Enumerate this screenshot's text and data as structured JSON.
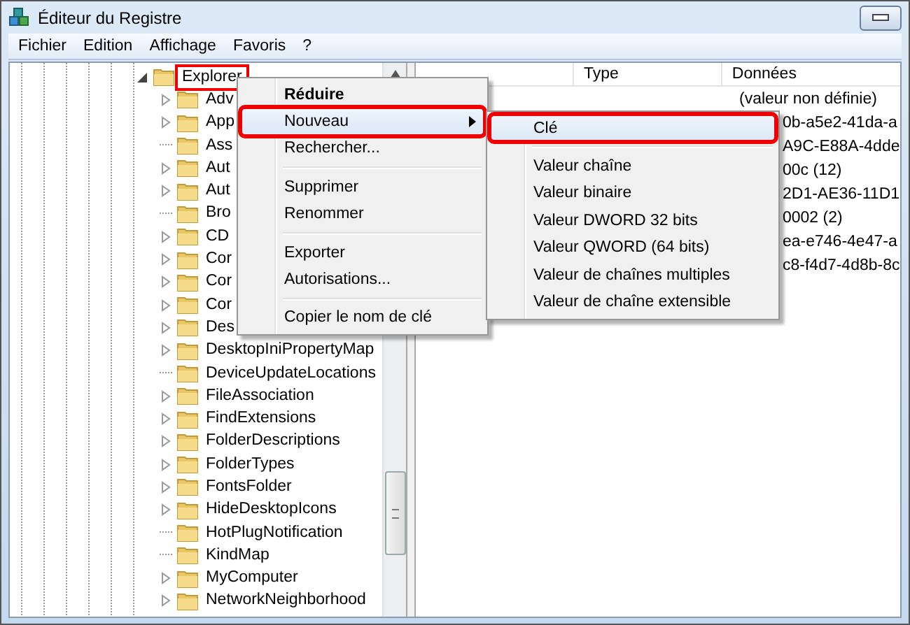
{
  "window": {
    "title": "Éditeur du Registre"
  },
  "menu_bar": [
    {
      "label": "Fichier"
    },
    {
      "label": "Edition"
    },
    {
      "label": "Affichage"
    },
    {
      "label": "Favoris"
    },
    {
      "label": "?"
    }
  ],
  "tree": {
    "items": [
      {
        "label": "Explorer",
        "expanded": true,
        "annotated": true,
        "children": [
          {
            "label": "Adv",
            "has_children": true
          },
          {
            "label": "App",
            "has_children": true
          },
          {
            "label": "Ass",
            "has_children": false
          },
          {
            "label": "Aut",
            "has_children": true
          },
          {
            "label": "Aut",
            "has_children": true
          },
          {
            "label": "Bro",
            "has_children": false
          },
          {
            "label": "CD",
            "has_children": true
          },
          {
            "label": "Cor",
            "has_children": true
          },
          {
            "label": "Cor",
            "has_children": true
          },
          {
            "label": "Cor",
            "has_children": true
          },
          {
            "label": "Des",
            "has_children": true
          },
          {
            "label": "DesktopIniPropertyMap",
            "has_children": true
          },
          {
            "label": "DeviceUpdateLocations",
            "has_children": false
          },
          {
            "label": "FileAssociation",
            "has_children": true
          },
          {
            "label": "FindExtensions",
            "has_children": true
          },
          {
            "label": "FolderDescriptions",
            "has_children": true
          },
          {
            "label": "FolderTypes",
            "has_children": true
          },
          {
            "label": "FontsFolder",
            "has_children": true
          },
          {
            "label": "HideDesktopIcons",
            "has_children": true
          },
          {
            "label": "HotPlugNotification",
            "has_children": false
          },
          {
            "label": "KindMap",
            "has_children": false
          },
          {
            "label": "MyComputer",
            "has_children": true
          },
          {
            "label": "NetworkNeighborhood",
            "has_children": true
          }
        ]
      }
    ]
  },
  "list": {
    "columns": [
      {
        "label": "Type"
      },
      {
        "label": "Données"
      }
    ],
    "rows": [
      {
        "data": "(valeur non définie)",
        "covered": false
      },
      {
        "data": "0b-a5e2-41da-a",
        "covered": true
      },
      {
        "data": "A9C-E88A-4dde",
        "covered": true
      },
      {
        "data": "00c (12)",
        "covered": true
      },
      {
        "data": "2D1-AE36-11D1",
        "covered": true
      },
      {
        "data": "0002 (2)",
        "covered": true
      },
      {
        "data": "ea-e746-4e47-a",
        "covered": true
      },
      {
        "data": "c8-f4d7-4d8b-8c",
        "covered": true
      }
    ]
  },
  "context_menu": {
    "items": [
      {
        "kind": "item",
        "label": "Réduire",
        "default": true,
        "selected": false,
        "annotated": false,
        "has_submenu": false
      },
      {
        "kind": "item",
        "label": "Nouveau",
        "default": false,
        "selected": true,
        "annotated": true,
        "has_submenu": true
      },
      {
        "kind": "item",
        "label": "Rechercher...",
        "default": false,
        "selected": false,
        "annotated": false,
        "has_submenu": false
      },
      {
        "kind": "separator"
      },
      {
        "kind": "item",
        "label": "Supprimer",
        "default": false,
        "selected": false,
        "annotated": false,
        "has_submenu": false
      },
      {
        "kind": "item",
        "label": "Renommer",
        "default": false,
        "selected": false,
        "annotated": false,
        "has_submenu": false
      },
      {
        "kind": "separator"
      },
      {
        "kind": "item",
        "label": "Exporter",
        "default": false,
        "selected": false,
        "annotated": false,
        "has_submenu": false
      },
      {
        "kind": "item",
        "label": "Autorisations...",
        "default": false,
        "selected": false,
        "annotated": false,
        "has_submenu": false
      },
      {
        "kind": "separator"
      },
      {
        "kind": "item",
        "label": "Copier le nom de clé",
        "default": false,
        "selected": false,
        "annotated": false,
        "has_submenu": false
      }
    ]
  },
  "submenu": {
    "items": [
      {
        "kind": "item",
        "label": "Clé",
        "selected": true,
        "annotated": true
      },
      {
        "kind": "separator"
      },
      {
        "kind": "item",
        "label": "Valeur chaîne",
        "selected": false,
        "annotated": false
      },
      {
        "kind": "item",
        "label": "Valeur binaire",
        "selected": false,
        "annotated": false
      },
      {
        "kind": "item",
        "label": "Valeur DWORD 32 bits",
        "selected": false,
        "annotated": false
      },
      {
        "kind": "item",
        "label": "Valeur QWORD (64 bits)",
        "selected": false,
        "annotated": false
      },
      {
        "kind": "item",
        "label": "Valeur de chaînes multiples",
        "selected": false,
        "annotated": false
      },
      {
        "kind": "item",
        "label": "Valeur de chaîne extensible",
        "selected": false,
        "annotated": false
      }
    ]
  }
}
